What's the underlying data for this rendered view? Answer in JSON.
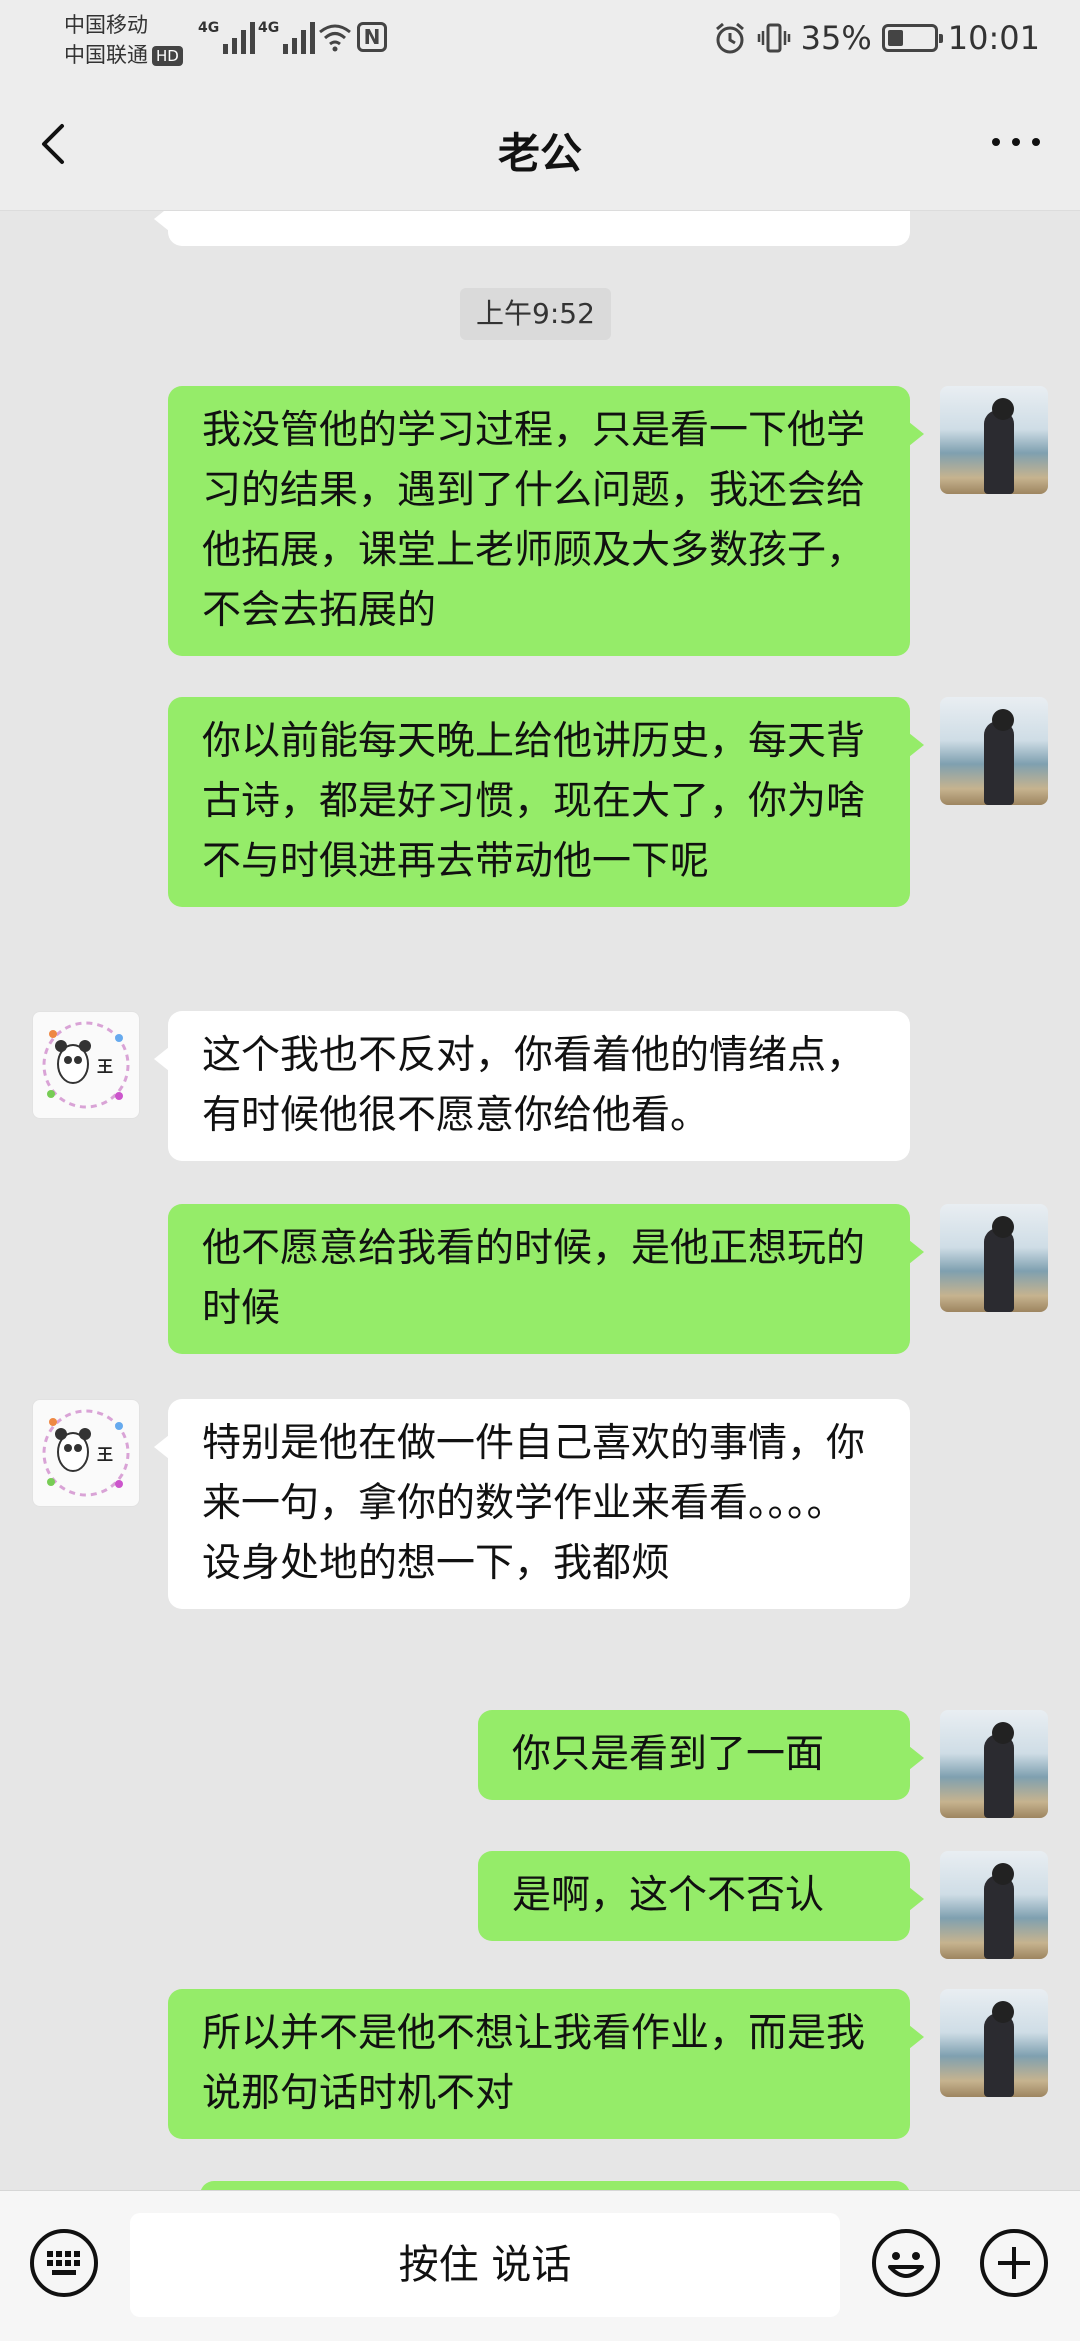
{
  "status_bar": {
    "carrier_1": "中国移动",
    "carrier_2": "中国联通",
    "hd_badge": "HD",
    "signal_label_1": "4G",
    "signal_label_2": "4G",
    "battery_percent": "35%",
    "battery_level": 0.35,
    "time": "10:01"
  },
  "header": {
    "title": "老公"
  },
  "chat": {
    "timestamp": "上午9:52",
    "messages": [
      {
        "from": "self",
        "text": "我没管他的学习过程，只是看一下他学习的结果，遇到了什么问题，我还会给他拓展，课堂上老师顾及大多数孩子，不会去拓展的"
      },
      {
        "from": "self",
        "text": "你以前能每天晚上给他讲历史，每天背古诗，都是好习惯，现在大了，你为啥不与时俱进再去带动他一下呢"
      },
      {
        "from": "other",
        "text": "这个我也不反对，你看着他的情绪点，有时候他很不愿意你给他看。"
      },
      {
        "from": "self",
        "text": "他不愿意给我看的时候，是他正想玩的时候"
      },
      {
        "from": "other",
        "text": "特别是他在做一件自己喜欢的事情，你来一句，拿你的数学作业来看看。。。。设身处地的想一下，我都烦"
      },
      {
        "from": "self",
        "text": "你只是看到了一面"
      },
      {
        "from": "self",
        "text": "是啊，这个不否认"
      },
      {
        "from": "self",
        "text": "所以并不是他不想让我看作业，而是我说那句话时机不对"
      }
    ],
    "contact_avatar_text": "王"
  },
  "input_bar": {
    "hold_to_talk": "按住 说话"
  },
  "colors": {
    "outgoing_bubble": "#95ec69",
    "incoming_bubble": "#ffffff",
    "background": "#e6e6e6"
  }
}
